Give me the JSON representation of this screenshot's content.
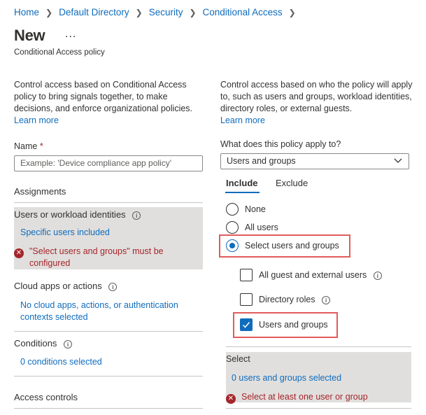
{
  "breadcrumb": [
    "Home",
    "Default Directory",
    "Security",
    "Conditional Access"
  ],
  "page": {
    "title": "New",
    "more": "...",
    "subtitle": "Conditional Access policy"
  },
  "left": {
    "intro": "Control access based on Conditional Access policy to bring signals together, to make decisions, and enforce organizational policies.",
    "learn_more": "Learn more",
    "name_label": "Name",
    "name_required": "*",
    "name_placeholder": "Example: 'Device compliance app policy'",
    "assignments": "Assignments",
    "users_heading": "Users or workload identities",
    "users_value": "Specific users included",
    "users_error": "\"Select users and groups\" must be configured",
    "cloud_heading": "Cloud apps or actions",
    "cloud_value": "No cloud apps, actions, or authentication contexts selected",
    "conditions_heading": "Conditions",
    "conditions_value": "0 conditions selected",
    "access_controls": "Access controls"
  },
  "right": {
    "intro": "Control access based on who the policy will apply to, such as users and groups, workload identities, directory roles, or external guests.",
    "learn_more": "Learn more",
    "apply_label": "What does this policy apply to?",
    "apply_value": "Users and groups",
    "tabs": [
      "Include",
      "Exclude"
    ],
    "radios": [
      "None",
      "All users",
      "Select users and groups"
    ],
    "checkboxes": [
      "All guest and external users",
      "Directory roles",
      "Users and groups"
    ],
    "select_heading": "Select",
    "select_value": "0 users and groups selected",
    "select_error": "Select at least one user or group"
  },
  "colors": {
    "accent": "#0f6cbd",
    "error": "#a4262c",
    "highlight": "#e35b5b",
    "panel": "#e1dfdd"
  }
}
